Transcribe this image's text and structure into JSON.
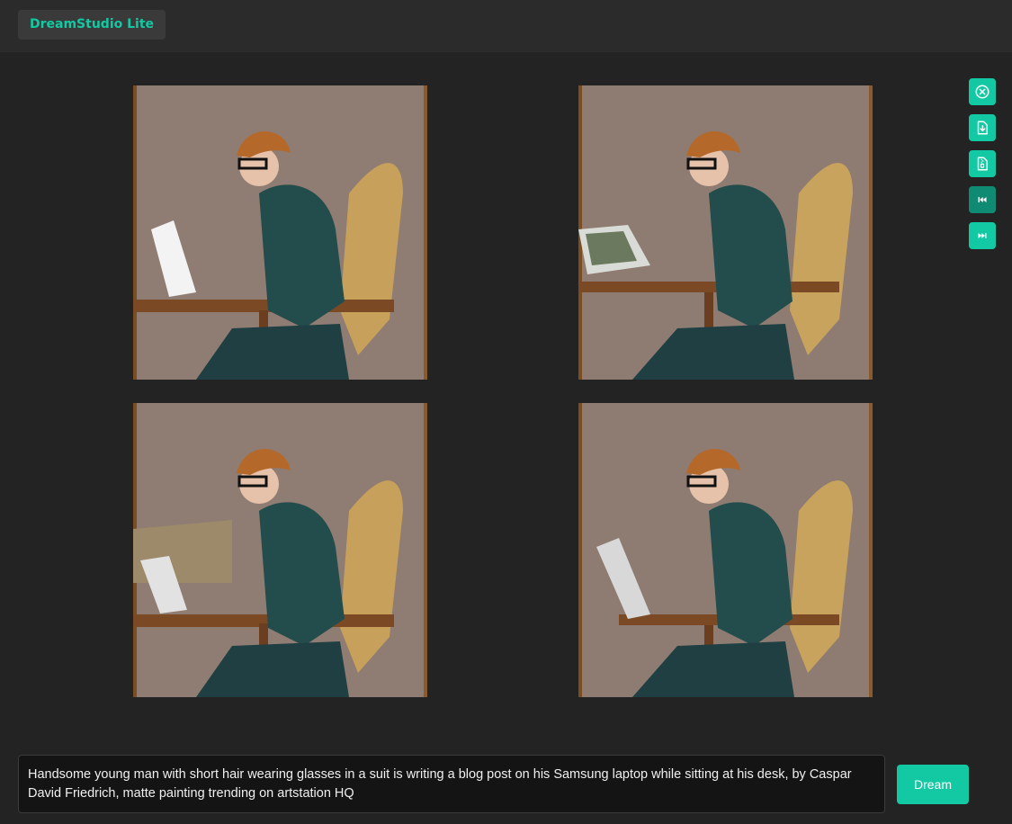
{
  "app": {
    "brand": "DreamStudio Lite"
  },
  "images": [
    {
      "label": "generated-image-1"
    },
    {
      "label": "generated-image-2"
    },
    {
      "label": "generated-image-3"
    },
    {
      "label": "generated-image-4"
    }
  ],
  "tools": [
    {
      "icon": "close-circle-icon"
    },
    {
      "icon": "download-icon"
    },
    {
      "icon": "zip-download-icon"
    },
    {
      "icon": "previous-icon"
    },
    {
      "icon": "next-icon"
    }
  ],
  "prompt": {
    "value": "Handsome young man with short hair wearing glasses in a suit is writing a blog post on his Samsung laptop while sitting at his desk, by Caspar David Friedrich, matte painting trending on artstation HQ"
  },
  "actions": {
    "dream_label": "Dream"
  },
  "colors": {
    "accent": "#12c9a3",
    "background": "#232323",
    "topbar": "#2b2b2b"
  }
}
